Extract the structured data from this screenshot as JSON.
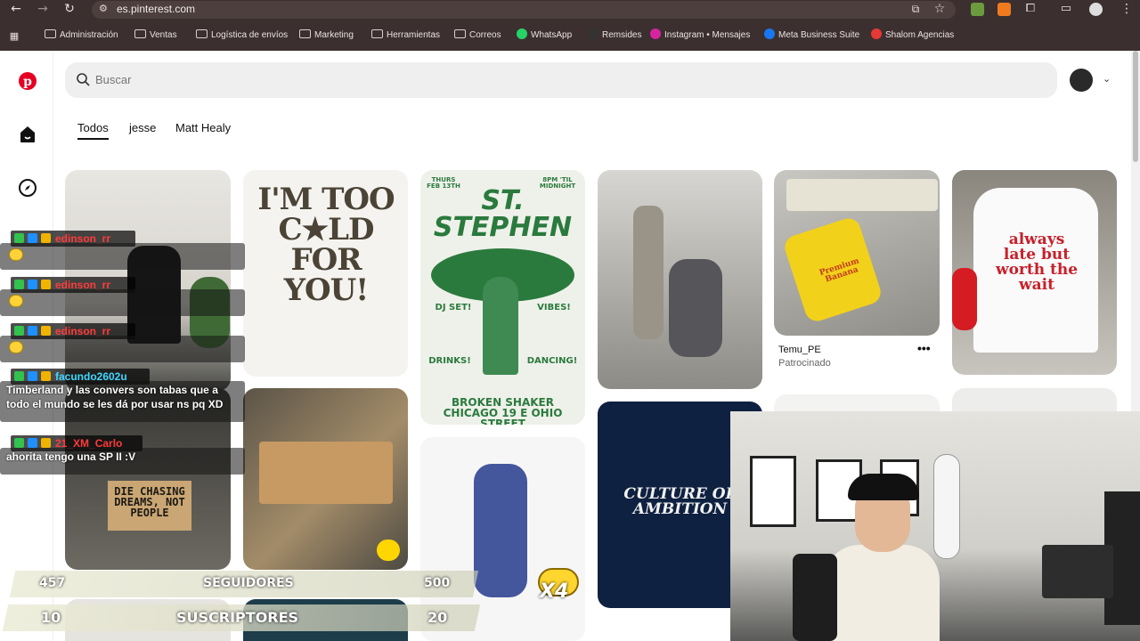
{
  "browser": {
    "url": "es.pinterest.com"
  },
  "bookmarks": [
    {
      "label": "Administración",
      "icon": "folder-icon"
    },
    {
      "label": "Ventas",
      "icon": "folder-icon"
    },
    {
      "label": "Logística de envíos",
      "icon": "folder-icon"
    },
    {
      "label": "Marketing",
      "icon": "folder-icon"
    },
    {
      "label": "Herramientas",
      "icon": "folder-icon"
    },
    {
      "label": "Correos",
      "icon": "folder-icon"
    },
    {
      "label": "WhatsApp",
      "icon": "whatsapp-icon",
      "color": "#25d366"
    },
    {
      "label": "Remsides",
      "icon": "remsides-icon",
      "color": "#333333"
    },
    {
      "label": "Instagram • Mensajes",
      "icon": "instagram-icon",
      "color": "#d6249f"
    },
    {
      "label": "Meta Business Suite",
      "icon": "meta-icon",
      "color": "#1877f2"
    },
    {
      "label": "Shalom Agencias",
      "icon": "shalom-icon",
      "color": "#e53935"
    }
  ],
  "search": {
    "placeholder": "Buscar"
  },
  "tabs": [
    {
      "label": "Todos",
      "active": true
    },
    {
      "label": "jesse",
      "active": false
    },
    {
      "label": "Matt Healy",
      "active": false
    }
  ],
  "pins": {
    "poster1": "I'M TOO C★LD FOR YOU!",
    "poster2_title": "ST. STEPHEN",
    "poster2_date": "THURS FEB 13TH",
    "poster2_time": "8PM 'TIL MIDNIGHT",
    "poster2_words": [
      "DJ SET!",
      "VIBES!",
      "DRINKS!",
      "DANCING!"
    ],
    "poster2_footer": "BROKEN SHAKER CHICAGO 19 E OHIO STREET",
    "sign": "DIE CHASING DREAMS, NOT PEOPLE",
    "culture": "CULTURE OF AMBITION",
    "shirt": "always late but worth the wait",
    "case": "Premium Banana",
    "temu_name": "Temu_PE",
    "temu_sponsored": "Patrocinado"
  },
  "chat": [
    {
      "user": "edinson_rr",
      "user_color": "#ff3b3b",
      "message": ""
    },
    {
      "user": "edinson_rr",
      "user_color": "#ff3b3b",
      "message": ""
    },
    {
      "user": "edinson_rr",
      "user_color": "#ff3b3b",
      "message": ""
    },
    {
      "user": "facundo2602u",
      "user_color": "#3fd8ff",
      "message": "Timberland y las convers son tabas que a todo el mundo se les dá por usar ns pq XD"
    },
    {
      "user": "21_XM_Carlo",
      "user_color": "#ff3b3b",
      "message": "ahorita tengo una SP II :V"
    }
  ],
  "goals": {
    "followers": {
      "current": "457",
      "label": "SEGUIDORES",
      "target": "500"
    },
    "subs": {
      "current": "10",
      "label": "SUSCRIPTORES",
      "target": "20"
    },
    "multiplier": "X4"
  },
  "colors": {
    "pinterest_red": "#e60023",
    "browser_bg": "#3c2f2f"
  }
}
